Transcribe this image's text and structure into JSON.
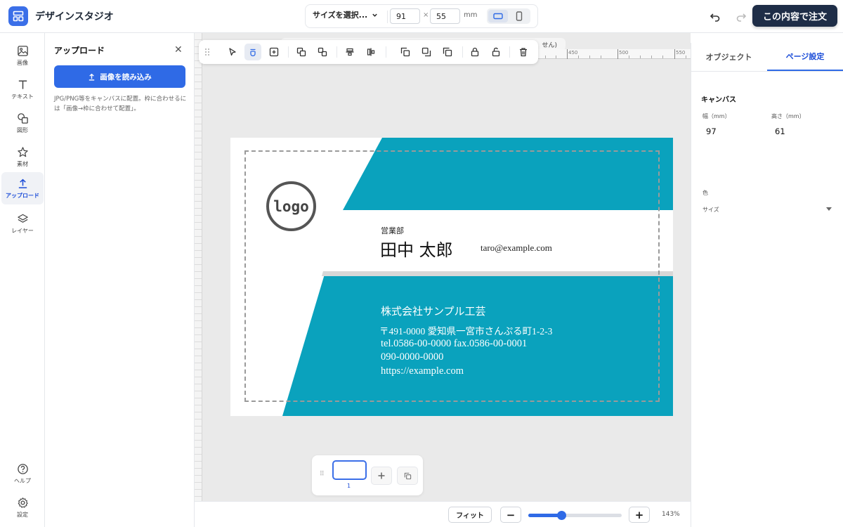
{
  "app": {
    "title": "デザインスタジオ"
  },
  "header": {
    "size_select_label": "サイズを選択...",
    "width_value": "91",
    "height_value": "55",
    "times": "×",
    "unit": "mm",
    "order_button": "この内容で注文"
  },
  "nav": {
    "items": [
      {
        "label": "画像",
        "icon": "image-icon"
      },
      {
        "label": "テキスト",
        "icon": "text-icon"
      },
      {
        "label": "図形",
        "icon": "shapes-icon"
      },
      {
        "label": "素材",
        "icon": "star-icon"
      },
      {
        "label": "アップロード",
        "icon": "upload-icon",
        "active": true
      },
      {
        "label": "レイヤー",
        "icon": "layers-icon"
      }
    ],
    "help": "ヘルプ",
    "settings": "設定"
  },
  "panel": {
    "title": "アップロード",
    "close": "✕",
    "upload_button": "画像を読み込み",
    "hint": "JPG/PNG等をキャンバスに配置。枠に合わせるには「画像→枠に合わせて配置」。"
  },
  "canvas": {
    "ruler_strip_text": "せん)",
    "ruler_labels": [
      "450",
      "500",
      "550"
    ]
  },
  "card": {
    "logo": "logo",
    "department": "営業部",
    "name": "田中 太郎",
    "email": "taro@example.com",
    "company": "株式会社サンプル工芸",
    "address": "〒491-0000 愛知県一宮市さんぷる町1-2-3",
    "tel_fax": "tel.0586-00-0000 fax.0586-00-0001",
    "mobile": "090-0000-0000",
    "url": "https://example.com",
    "accent_color": "#0aa2bd"
  },
  "pages": {
    "current": "1"
  },
  "bottom": {
    "fit": "フィット",
    "zoom_out": "−",
    "zoom_in": "+",
    "zoom_label": "143%",
    "zoom_level": 0.35
  },
  "rpanel": {
    "tabs": [
      "オブジェクト",
      "ページ設定"
    ],
    "active_tab": "ページ設定",
    "section": "キャンバス",
    "width_label": "幅（mm）",
    "width_value": "97",
    "height_label": "高さ（mm）",
    "height_value": "61",
    "color_label": "色",
    "size_label": "サイズ"
  }
}
